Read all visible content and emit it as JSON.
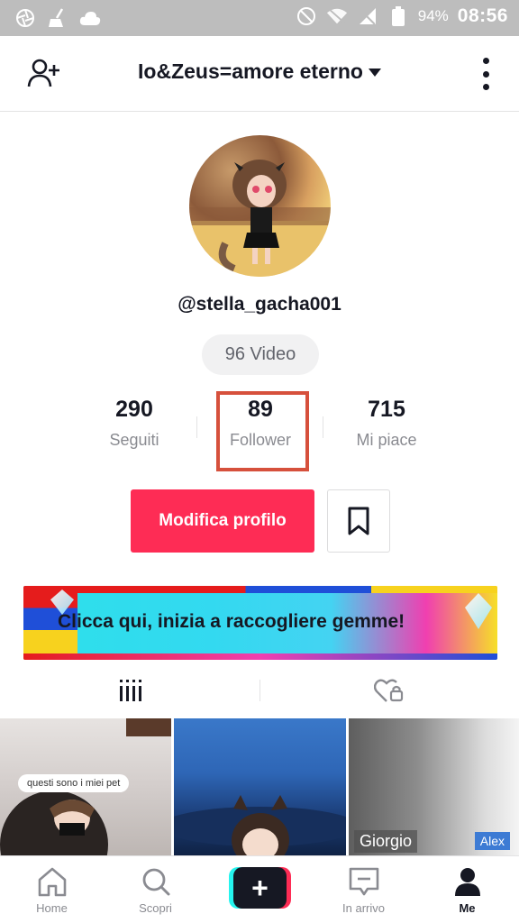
{
  "status_bar": {
    "battery_percent": "94%",
    "time": "08:56"
  },
  "header": {
    "title": "Io&Zeus=amore eterno"
  },
  "profile": {
    "username": "@stella_gacha001",
    "videos_pill": "96 Video",
    "stats": [
      {
        "value": "290",
        "label": "Seguiti"
      },
      {
        "value": "89",
        "label": "Follower"
      },
      {
        "value": "715",
        "label": "Mi piace"
      }
    ],
    "edit_button": "Modifica profilo"
  },
  "banner": {
    "text": "Clicca qui, inizia a raccogliere gemme!"
  },
  "grid": {
    "items": [
      {
        "caption": "questi sono i miei pet"
      },
      {
        "caption": ""
      },
      {
        "tag1": "Giorgio",
        "tag2": "Alex"
      }
    ]
  },
  "bottom_nav": {
    "items": [
      {
        "label": "Home"
      },
      {
        "label": "Scopri"
      },
      {
        "label": "In arrivo"
      },
      {
        "label": "Me"
      }
    ]
  },
  "colors": {
    "accent": "#fe2c55",
    "highlight_box": "#d6503c",
    "cyan": "#25f4ee"
  }
}
